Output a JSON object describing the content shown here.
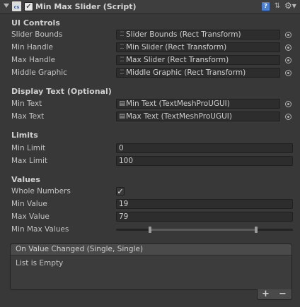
{
  "header": {
    "title": "Min Max Slider (Script)",
    "script_icon": "cs",
    "enabled": true,
    "icons": [
      "fold-arrow-icon",
      "script-icon",
      "book-icon",
      "preset-icon",
      "gear-icon"
    ]
  },
  "sections": {
    "ui_controls": {
      "title": "UI Controls",
      "fields": [
        {
          "label": "Slider Bounds",
          "value": "Slider Bounds (Rect Transform)",
          "icon": "rect-transform-icon"
        },
        {
          "label": "Min Handle",
          "value": "Min Slider (Rect Transform)",
          "icon": "rect-transform-icon"
        },
        {
          "label": "Max Handle",
          "value": "Max Slider (Rect Transform)",
          "icon": "rect-transform-icon"
        },
        {
          "label": "Middle Graphic",
          "value": "Middle Graphic (Rect Transform)",
          "icon": "rect-transform-icon"
        }
      ]
    },
    "display_text": {
      "title": "Display Text (Optional)",
      "fields": [
        {
          "label": "Min Text",
          "value": "Min Text (TextMeshProUGUI)",
          "icon": "document-icon"
        },
        {
          "label": "Max Text",
          "value": "Max Text (TextMeshProUGUI)",
          "icon": "document-icon"
        }
      ]
    },
    "limits": {
      "title": "Limits",
      "fields": [
        {
          "label": "Min Limit",
          "value": "0"
        },
        {
          "label": "Max Limit",
          "value": "100"
        }
      ]
    },
    "values": {
      "title": "Values",
      "whole_numbers_label": "Whole Numbers",
      "whole_numbers_checked": true,
      "min_value_label": "Min Value",
      "min_value": "19",
      "max_value_label": "Max Value",
      "max_value": "79",
      "min_max_label": "Min Max Values",
      "slider_min_fraction": 0.19,
      "slider_max_fraction": 0.79
    }
  },
  "event": {
    "title": "On Value Changed (Single, Single)",
    "empty_text": "List is Empty",
    "add_label": "+",
    "remove_label": "−"
  }
}
